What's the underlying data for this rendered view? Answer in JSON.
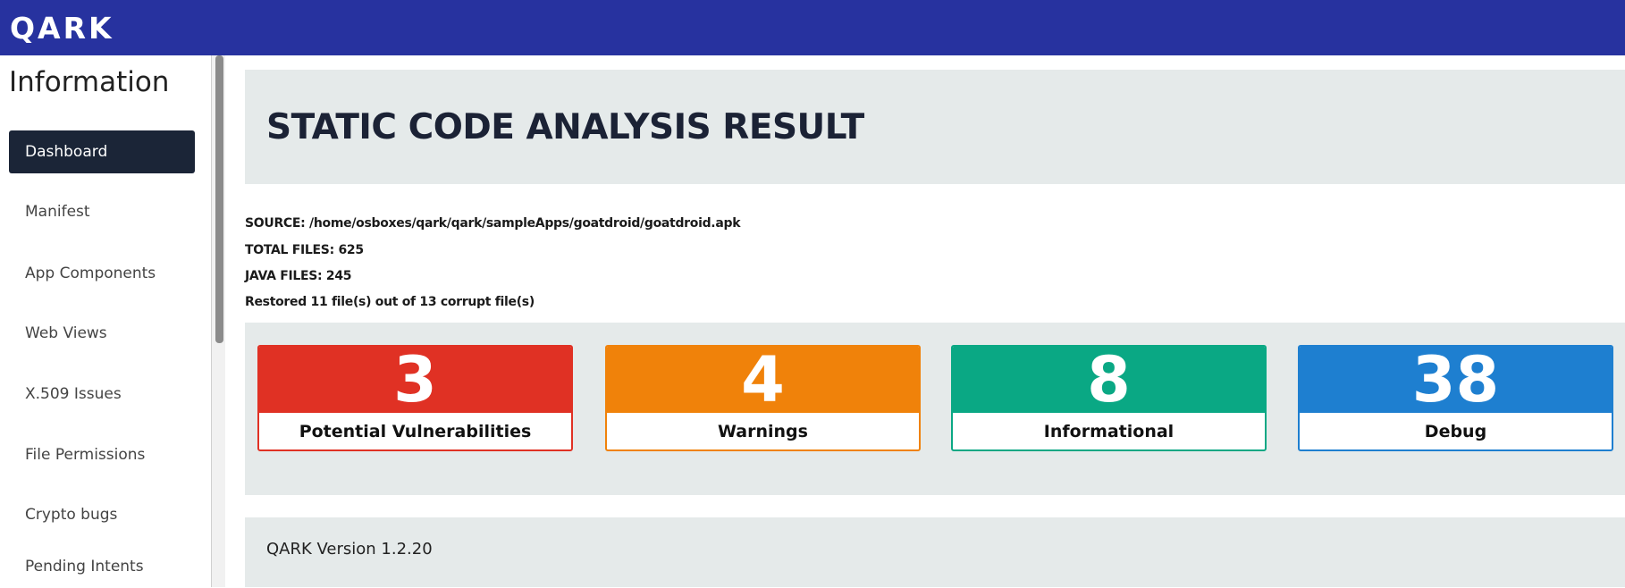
{
  "app": {
    "logo": "QARK"
  },
  "sidebar": {
    "title": "Information",
    "items": [
      {
        "label": "Dashboard"
      },
      {
        "label": "Manifest"
      },
      {
        "label": "App Components"
      },
      {
        "label": "Web Views"
      },
      {
        "label": "X.509 Issues"
      },
      {
        "label": "File Permissions"
      },
      {
        "label": "Crypto bugs"
      },
      {
        "label": "Pending Intents"
      }
    ]
  },
  "main": {
    "title": "STATIC CODE ANALYSIS RESULT",
    "source": "SOURCE: /home/osboxes/qark/qark/sampleApps/goatdroid/goatdroid.apk",
    "total_files": "TOTAL FILES: 625",
    "java_files": "JAVA FILES: 245",
    "restored": "Restored 11 file(s) out of 13 corrupt file(s)",
    "cards": [
      {
        "count": "3",
        "label": "Potential Vulnerabilities",
        "color": "#e03124"
      },
      {
        "count": "4",
        "label": "Warnings",
        "color": "#f0820a"
      },
      {
        "count": "8",
        "label": "Informational",
        "color": "#0aa884"
      },
      {
        "count": "38",
        "label": "Debug",
        "color": "#1e7fd0"
      }
    ],
    "version": "QARK Version 1.2.20"
  }
}
